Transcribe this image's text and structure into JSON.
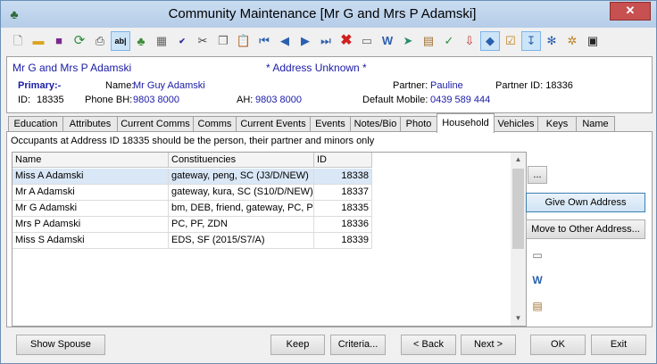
{
  "window": {
    "title": "Community Maintenance  [Mr G and Mrs P Adamski]"
  },
  "toolbar": {
    "icons": [
      "new-icon",
      "open-folder-icon",
      "save-icon",
      "refresh-icon",
      "print-icon",
      "text-field-icon",
      "tree-icon",
      "calculator-icon",
      "spell-check-icon",
      "cut-icon",
      "copy-icon",
      "paste-icon",
      "first-record-icon",
      "previous-record-icon",
      "next-record-icon",
      "last-record-icon",
      "delete-icon",
      "card-icon",
      "word-icon",
      "send-icon",
      "clipboard-icon",
      "approve-icon",
      "download-icon",
      "tag-icon",
      "checklist-icon",
      "pin-icon",
      "group-icon",
      "people-icon",
      "exit-icon"
    ]
  },
  "header": {
    "name": "Mr G and Mrs P Adamski",
    "address_status": "* Address Unknown *",
    "primary_label": "Primary:-",
    "name_label": "Name:",
    "name_value": "Mr Guy Adamski",
    "partner_label": "Partner:",
    "partner_value": "Pauline",
    "partner_id_label": "Partner ID: 18336",
    "id_label": "ID:",
    "id_value": "18335",
    "phone_bh_label": "Phone BH:",
    "phone_bh_value": "9803 8000",
    "ah_label": "AH:",
    "ah_value": "9803 8000",
    "mobile_label": "Default Mobile:",
    "mobile_value": "0439 589 444"
  },
  "tabs": [
    "Education",
    "Attributes",
    "Current Comms",
    "Comms",
    "Current Events",
    "Events",
    "Notes/Bio",
    "Photo",
    "Household",
    "Vehicles",
    "Keys",
    "Name"
  ],
  "active_tab": "Household",
  "household": {
    "info": "Occupants at Address ID 18335 should be the person, their partner and minors only",
    "columns": [
      "Name",
      "Constituencies",
      "ID"
    ],
    "rows": [
      {
        "name": "Miss A Adamski",
        "constituencies": "gateway, peng, SC (J3/D/NEW)",
        "id": "18338"
      },
      {
        "name": "Mr A Adamski",
        "constituencies": "gateway, kura, SC (S10/D/NEW)",
        "id": "18337"
      },
      {
        "name": "Mr G Adamski",
        "constituencies": "bm, DEB, friend, gateway, PC, PF",
        "id": "18335"
      },
      {
        "name": "Mrs P Adamski",
        "constituencies": "PC, PF, ZDN",
        "id": "18336"
      },
      {
        "name": "Miss S Adamski",
        "constituencies": "EDS, SF (2015/S7/A)",
        "id": "18339"
      }
    ],
    "ellipsis_label": "...",
    "give_own_address_label": "Give Own Address",
    "move_label": "Move to Other Address..."
  },
  "footer": {
    "show_spouse": "Show Spouse",
    "keep": "Keep",
    "criteria": "Criteria...",
    "back": "< Back",
    "next": "Next >",
    "ok": "OK",
    "exit": "Exit"
  },
  "colors": {
    "accent_blue": "#1a1aa6",
    "selected_row": "#d9e7f6",
    "close_red": "#c75050"
  }
}
